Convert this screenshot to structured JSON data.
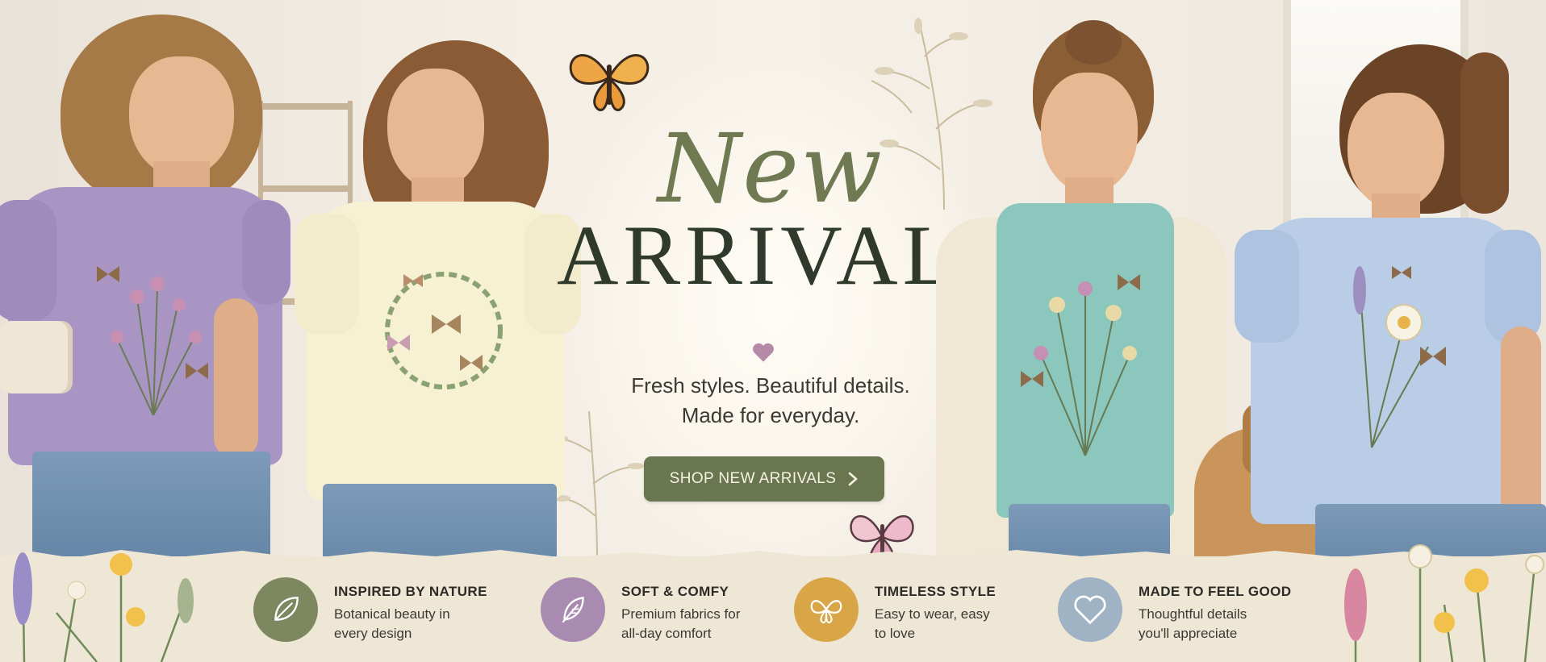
{
  "hero": {
    "headline_script": "New",
    "headline_main": "ARRIVALS",
    "tagline_line1": "Fresh styles. Beautiful details.",
    "tagline_line2": "Made for everyday.",
    "cta_label": "SHOP NEW ARRIVALS",
    "cta_icon": "chevron-right-icon"
  },
  "features": [
    {
      "icon": "leaf-icon",
      "color": "#7d8760",
      "title": "INSPIRED BY NATURE",
      "desc_line1": "Botanical beauty in",
      "desc_line2": "every design"
    },
    {
      "icon": "feather-icon",
      "color": "#a98ab0",
      "title": "SOFT & COMFY",
      "desc_line1": "Premium fabrics for",
      "desc_line2": "all-day comfort"
    },
    {
      "icon": "butterfly-icon",
      "color": "#d8a646",
      "title": "TIMELESS STYLE",
      "desc_line1": "Easy to wear, easy",
      "desc_line2": "to love"
    },
    {
      "icon": "heart-icon",
      "color": "#9fb3c4",
      "title": "MADE TO FEEL GOOD",
      "desc_line1": "Thoughtful details",
      "desc_line2": "you'll appreciate"
    }
  ],
  "colors": {
    "accent_green": "#6a7650",
    "headline_dark": "#2f3a2c",
    "script_green": "#6f7a52",
    "heart_mauve": "#b48aa8",
    "shirt_lavender": "#a895c4",
    "shirt_cream": "#f7f1d3",
    "shirt_mint": "#8cc7be",
    "shirt_blue": "#b9cde6"
  }
}
